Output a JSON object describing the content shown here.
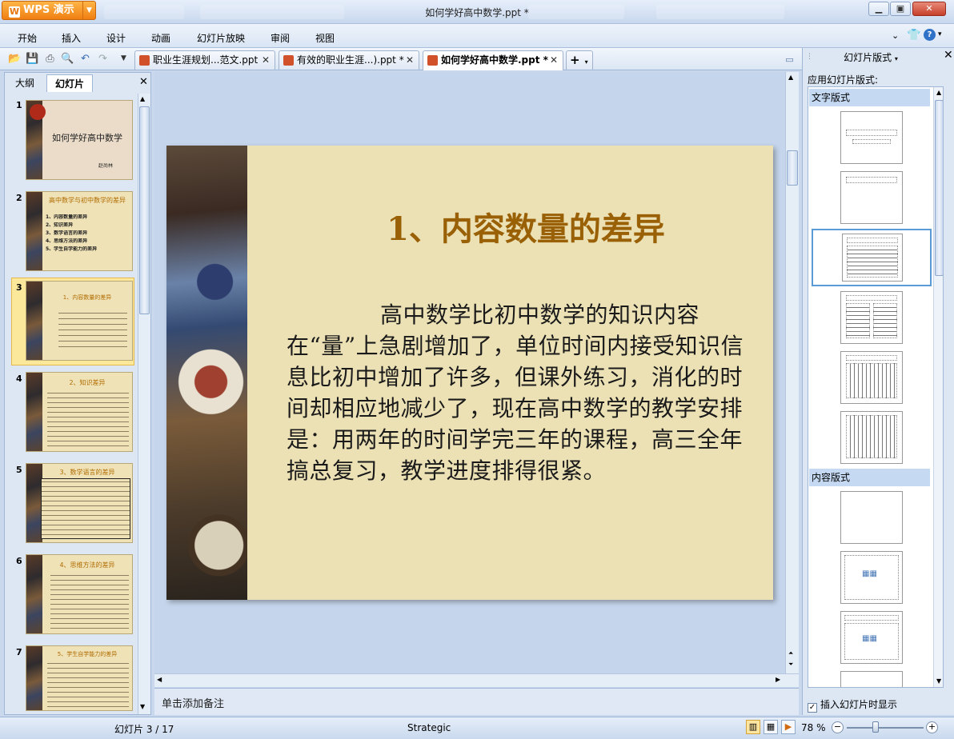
{
  "app": {
    "brand": "WPS 演示",
    "window_title": "如何学好高中数学.ppt *"
  },
  "menu": [
    "开始",
    "插入",
    "设计",
    "动画",
    "幻灯片放映",
    "审阅",
    "视图"
  ],
  "doc_tabs": [
    {
      "label": "职业生涯规划...范文.ppt",
      "active": false
    },
    {
      "label": "有效的职业生涯...).ppt *",
      "active": false
    },
    {
      "label": "如何学好高中数学.ppt *",
      "active": true
    }
  ],
  "left_panel": {
    "tabs": [
      "大纲",
      "幻灯片"
    ],
    "active_tab": "幻灯片",
    "slides": [
      {
        "num": "1",
        "title": "如何学好高中数学",
        "subtitle": "赵尚林"
      },
      {
        "num": "2",
        "title": "高中数学与初中数学的差异",
        "lines": [
          "1、内容数量的差异",
          "2、知识差异",
          "3、数学语言的差异",
          "4、思维方法的差异",
          "5、学生自学能力的差异"
        ]
      },
      {
        "num": "3",
        "title": "1、内容数量的差异",
        "selected": true
      },
      {
        "num": "4",
        "title": "2、知识差异"
      },
      {
        "num": "5",
        "title": "3、数学语言的差异"
      },
      {
        "num": "6",
        "title": "4、思维方法的差异"
      },
      {
        "num": "7",
        "title": "5、学生自学能力的差异"
      }
    ]
  },
  "slide": {
    "title": "1、内容数量的差异",
    "body": "高中数学比初中数学的知识内容在“量”上急剧增加了，单位时间内接受知识信息比初中增加了许多，但课外练习，消化的时间却相应地减少了，现在高中数学的教学安排是：用两年的时间学完三年的课程，高三全年搞总复习，教学进度排得很紧。"
  },
  "notes_placeholder": "单击添加备注",
  "right_panel": {
    "title": "幻灯片版式",
    "apply_label": "应用幻灯片版式:",
    "sections": [
      "文字版式",
      "内容版式"
    ],
    "checkbox_label": "插入幻灯片时显示",
    "checkbox_checked": true
  },
  "status": {
    "slide_counter": "幻灯片 3 / 17",
    "theme": "Strategic",
    "zoom": "78 %",
    "zoom_level_percent": 78
  },
  "colors": {
    "accent": "#f08a1c",
    "slide_bg": "#ece1b5",
    "slide_title": "#9a6006",
    "selection": "#5b9bd5"
  },
  "icons": [
    "open-icon",
    "save-icon",
    "print-icon",
    "print-preview-icon",
    "undo-icon",
    "redo-icon",
    "dropdown-icon",
    "new-tab-icon",
    "help-icon",
    "shirt-icon",
    "checkmark-icon"
  ]
}
